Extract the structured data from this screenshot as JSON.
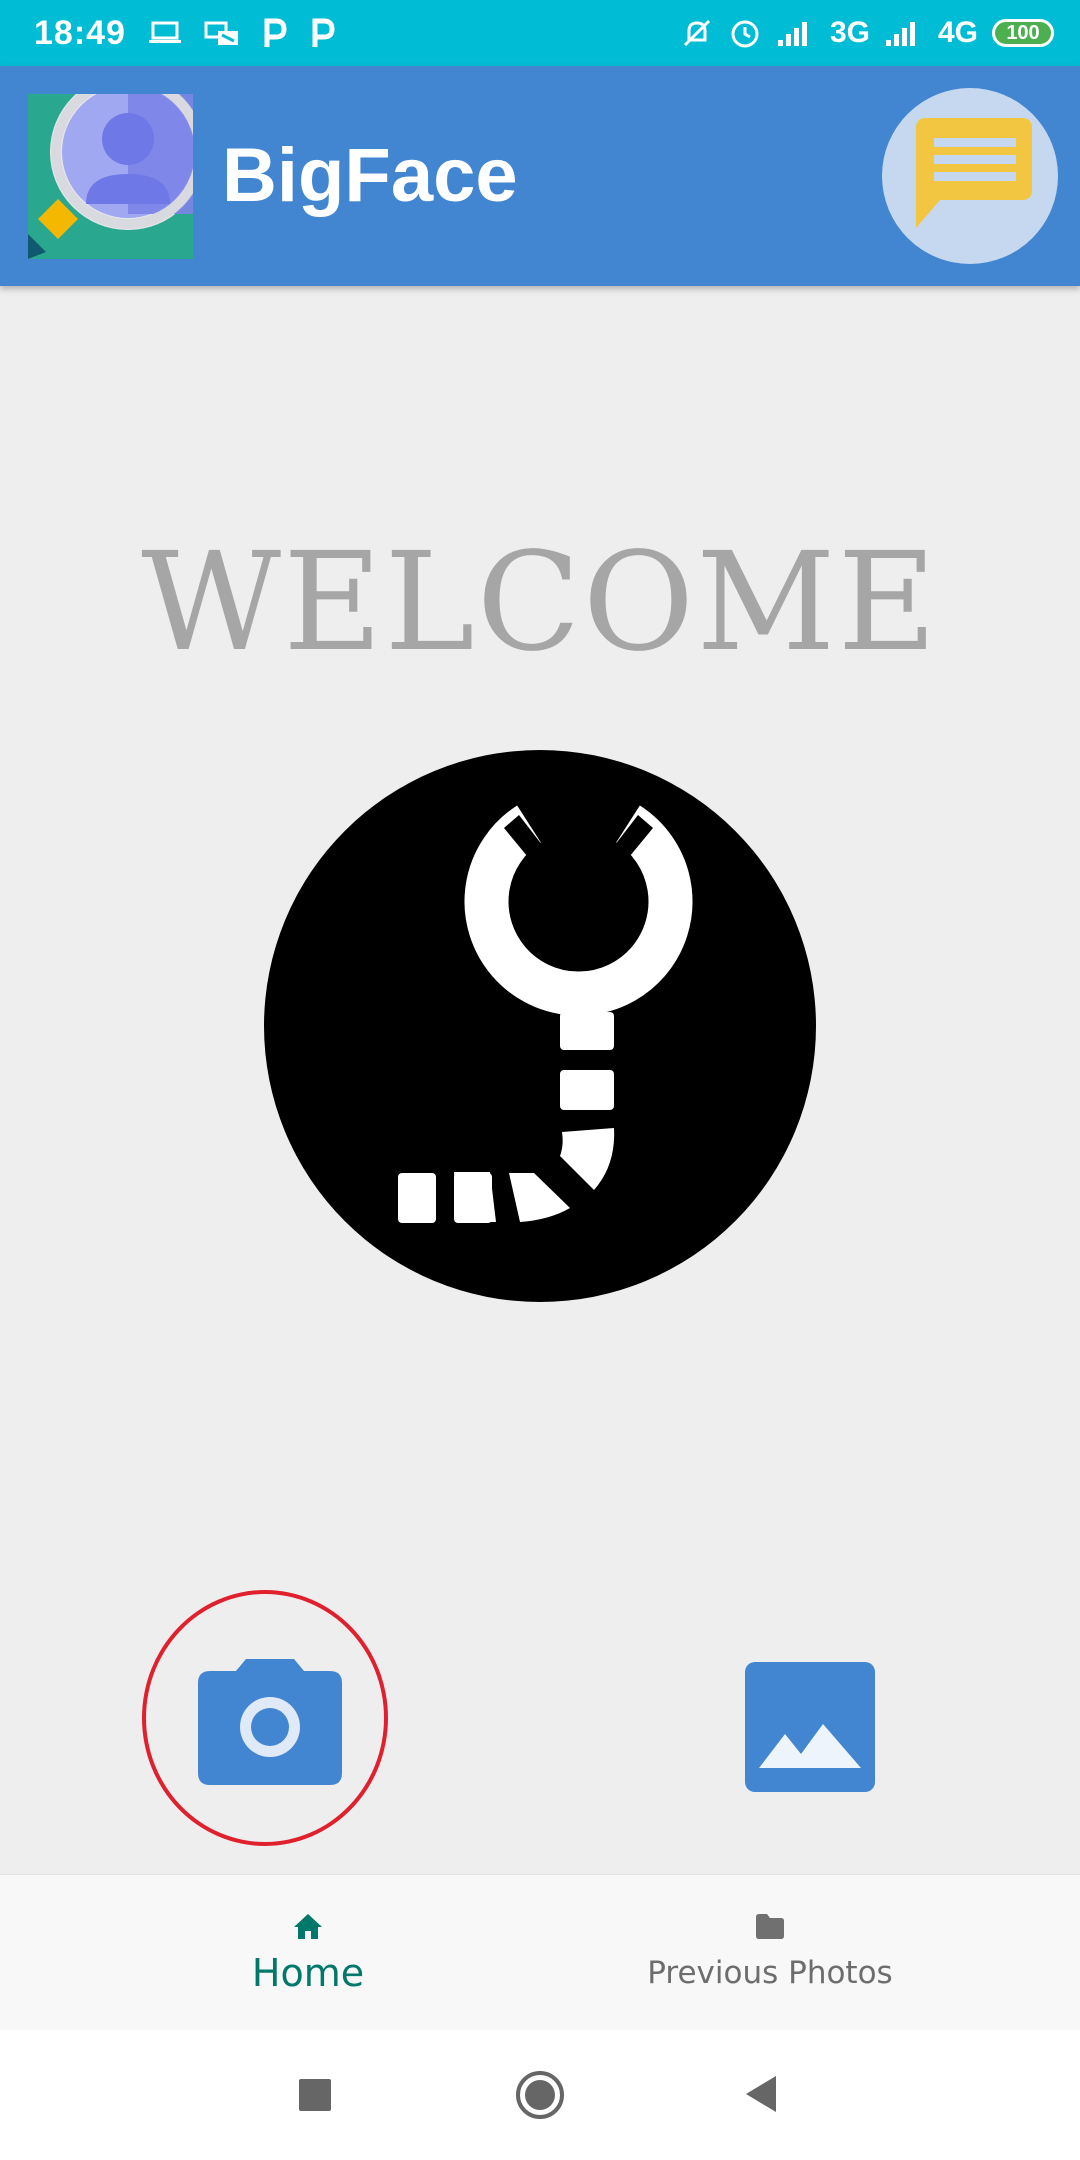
{
  "status_bar": {
    "time": "18:49",
    "network_1": "3G",
    "network_2": "4G",
    "battery": "100"
  },
  "app_bar": {
    "title": "BigFace",
    "logo_icon": "face-search-logo",
    "action_icon": "chat-message-icon"
  },
  "main": {
    "welcome_text": "WELCOME",
    "emblem_icon": "bigface-emblem",
    "camera_icon": "camera-icon",
    "gallery_icon": "image-gallery-icon",
    "highlight_color": "#e0202c"
  },
  "bottom_nav": {
    "items": [
      {
        "label": "Home",
        "icon": "home-icon",
        "active": true
      },
      {
        "label": "Previous Photos",
        "icon": "folder-icon",
        "active": false
      }
    ],
    "active_color": "#00796b"
  },
  "colors": {
    "status_bar": "#00bcd4",
    "app_bar": "#4285d1",
    "background": "#eeeeee"
  }
}
